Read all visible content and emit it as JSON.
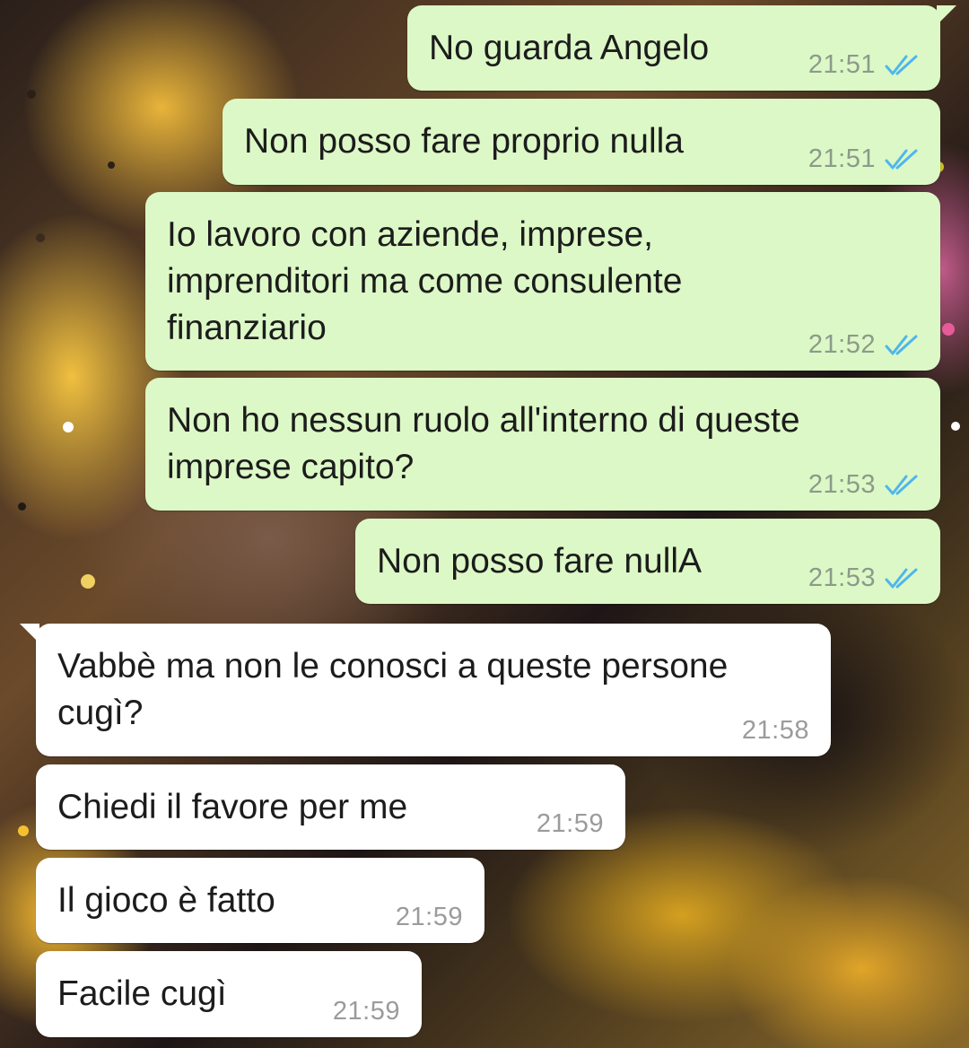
{
  "wallpaper": {
    "colors": [
      "#2a1f1a",
      "#e8b43a",
      "#c05a88",
      "#1a1414"
    ]
  },
  "messages": [
    {
      "dir": "out",
      "text": "No guarda Angelo",
      "time": "21:51",
      "status": "read-double-check-icon"
    },
    {
      "dir": "out",
      "text": "Non posso fare proprio nulla",
      "time": "21:51",
      "status": "read-double-check-icon"
    },
    {
      "dir": "out",
      "text": "Io lavoro con aziende, imprese,\nimprenditori ma come consulente\nfinanziario",
      "time": "21:52",
      "status": "read-double-check-icon"
    },
    {
      "dir": "out",
      "text": "Non ho nessun ruolo all'interno di queste\nimprese capito?",
      "time": "21:53",
      "status": "read-double-check-icon"
    },
    {
      "dir": "out",
      "text": "Non posso fare nullA",
      "time": "21:53",
      "status": "read-double-check-icon"
    },
    {
      "dir": "in",
      "text": "Vabbè ma non le conosci a queste persone\ncugì?",
      "time": "21:58"
    },
    {
      "dir": "in",
      "text": "Chiedi il favore per me",
      "time": "21:59"
    },
    {
      "dir": "in",
      "text": "Il gioco è fatto",
      "time": "21:59"
    },
    {
      "dir": "in",
      "text": "Facile cugì",
      "time": "21:59"
    }
  ],
  "colors": {
    "outgoing_bubble": "#dcf8c6",
    "incoming_bubble": "#ffffff",
    "read_tick": "#4fb6ec"
  }
}
